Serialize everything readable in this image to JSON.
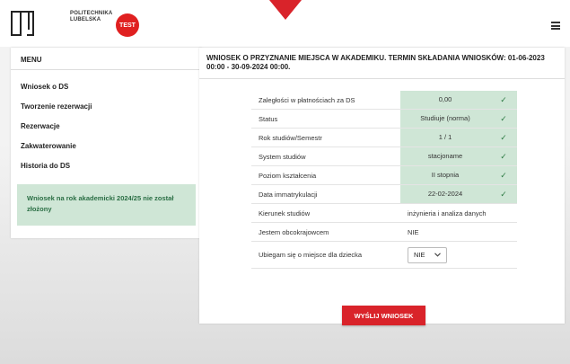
{
  "header": {
    "logo_text_line1": "POLITECHNIKA",
    "logo_text_line2": "LUBELSKA",
    "badge": "TEST",
    "accent": "#d9232a"
  },
  "menu": {
    "title": "MENU",
    "items": [
      "Wniosek o DS",
      "Tworzenie rezerwacji",
      "Rezerwacje",
      "Zakwaterowanie",
      "Historia do DS"
    ],
    "notice": "Wniosek na rok akademicki 2024/25 nie został złożony"
  },
  "panel": {
    "title": "WNIOSEK O PRZYZNANIE MIEJSCA W AKADEMIKU. TERMIN SKŁADANIA WNIOSKÓW: 01-06-2023 00:00 - 30-09-2024 00:00.",
    "rows": [
      {
        "label": "Zaległości w płatnościach za DS",
        "value": "0,00"
      },
      {
        "label": "Status",
        "value": "Studiuje (norma)"
      },
      {
        "label": "Rok studiów/Semestr",
        "value": "1 / 1"
      },
      {
        "label": "System studiów",
        "value": "stacjoname"
      },
      {
        "label": "Poziom kształcenia",
        "value": "II stopnia"
      },
      {
        "label": "Data immatrykulacji",
        "value": "22-02-2024"
      },
      {
        "label": "Kierunek studiów",
        "value": "inżynieria i analiza danych"
      },
      {
        "label": "Jestem obcokrajowcem",
        "value": "NIE"
      }
    ],
    "child_label": "Ubiegam się o miejsce dla dziecka",
    "child_value": "NIE",
    "submit": "WYŚLIJ WNIOSEK"
  }
}
